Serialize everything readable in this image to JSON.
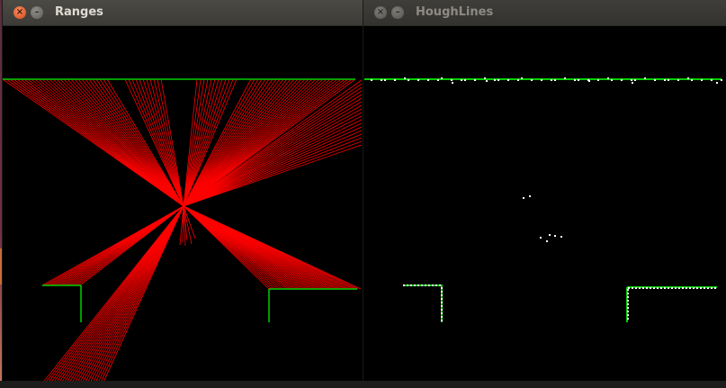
{
  "windows": [
    {
      "title": "Ranges",
      "active": true,
      "close_glyph": "×",
      "minimize_glyph": "–"
    },
    {
      "title": "HoughLines",
      "active": false,
      "close_glyph": "×",
      "minimize_glyph": "–"
    }
  ],
  "colors": {
    "ray": "#ff0000",
    "line": "#00d000",
    "point": "#ffffff",
    "background": "#000000"
  },
  "icons": {
    "close": "close-icon",
    "minimize": "minimize-icon"
  }
}
